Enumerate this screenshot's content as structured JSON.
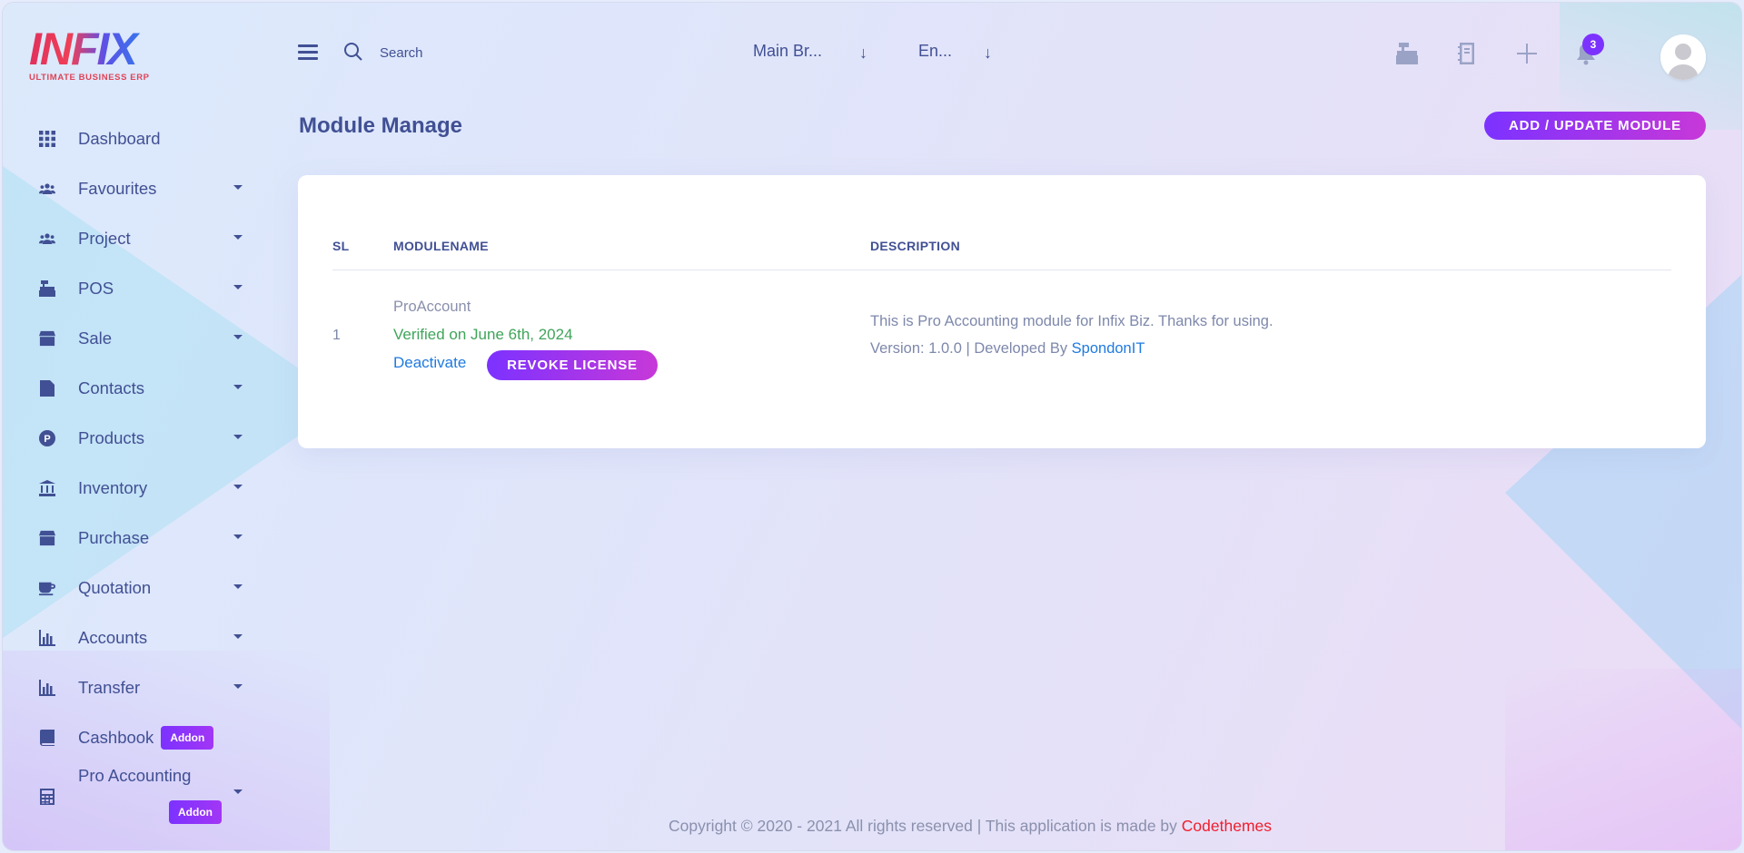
{
  "brand": {
    "logo_text": "INFIX",
    "logo_sub": "ULTIMATE BUSINESS ERP"
  },
  "sidebar": {
    "items": [
      {
        "label": "Dashboard",
        "icon": "grid-icon"
      },
      {
        "label": "Favourites",
        "icon": "users-icon"
      },
      {
        "label": "Project",
        "icon": "users-icon"
      },
      {
        "label": "POS",
        "icon": "cash-register-icon"
      },
      {
        "label": "Sale",
        "icon": "store-icon"
      },
      {
        "label": "Contacts",
        "icon": "contact-file-icon"
      },
      {
        "label": "Products",
        "icon": "product-p-icon"
      },
      {
        "label": "Inventory",
        "icon": "bank-icon"
      },
      {
        "label": "Purchase",
        "icon": "store-icon"
      },
      {
        "label": "Quotation",
        "icon": "coffee-icon"
      },
      {
        "label": "Accounts",
        "icon": "bar-chart-icon"
      },
      {
        "label": "Transfer",
        "icon": "bar-chart-icon"
      },
      {
        "label": "Cashbook",
        "icon": "book-icon",
        "badge": "Addon"
      },
      {
        "label": "Pro Accounting",
        "icon": "calculator-icon",
        "badge": "Addon"
      }
    ]
  },
  "header": {
    "search_placeholder": "Search",
    "branch_select": "Main Br...",
    "lang_select": "En...",
    "select_arrow": "↓",
    "notification_count": "3",
    "icons": [
      "cash-register-icon",
      "notebook-icon",
      "plus-icon",
      "bell-icon"
    ]
  },
  "page": {
    "title": "Module Manage",
    "add_button": "ADD / UPDATE MODULE"
  },
  "table": {
    "headers": {
      "sl": "SL",
      "name": "MODULENAME",
      "description": "DESCRIPTION"
    },
    "rows": [
      {
        "sl": "1",
        "module_name": "ProAccount",
        "verified": "Verified on June 6th, 2024",
        "deactivate": "Deactivate",
        "revoke": "REVOKE LICENSE",
        "description": "This is Pro Accounting module for Infix Biz. Thanks for using.",
        "version": "Version: 1.0.0 | Developed By ",
        "developer": "SpondonIT"
      }
    ]
  },
  "footer": {
    "text": "Copyright © 2020 - 2021 All rights reserved | This application is made by ",
    "link": "Codethemes"
  },
  "colors": {
    "primary_text": "#415094",
    "accent_gradient_start": "#7c32ff",
    "accent_gradient_end": "#c738d8",
    "verified_green": "#3fa55a",
    "link_blue": "#1f7ae0",
    "footer_link_red": "#f01e2c"
  }
}
